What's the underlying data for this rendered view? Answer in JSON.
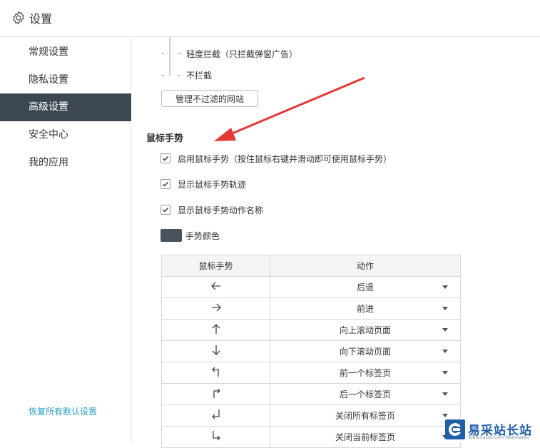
{
  "header": {
    "title": "设置",
    "icon": "gear-icon"
  },
  "sidebar": {
    "items": [
      {
        "label": "常规设置"
      },
      {
        "label": "隐私设置"
      },
      {
        "label": "高级设置"
      },
      {
        "label": "安全中心"
      },
      {
        "label": "我的应用"
      }
    ],
    "active_index": 2,
    "restore_label": "恢复所有默认设置"
  },
  "adblock": {
    "option_light": "轻度拦截（只拦截弹窗广告）",
    "option_none": "不拦截",
    "manage_button": "管理不过滤的网站"
  },
  "gesture": {
    "section_title": "鼠标手势",
    "enable_label": "启用鼠标手势（按住鼠标右键并滑动即可使用鼠标手势）",
    "trail_label": "显示鼠标手势轨迹",
    "name_label": "显示鼠标手势动作名称",
    "color_label": "手势颜色",
    "color": "#48535e",
    "table": {
      "col_gesture": "鼠标手势",
      "col_action": "动作",
      "rows": [
        {
          "gesture_icon": "arrow-left-icon",
          "action": "后退"
        },
        {
          "gesture_icon": "arrow-right-icon",
          "action": "前进"
        },
        {
          "gesture_icon": "arrow-up-icon",
          "action": "向上滚动页面"
        },
        {
          "gesture_icon": "arrow-down-icon",
          "action": "向下滚动页面"
        },
        {
          "gesture_icon": "arrow-up-left-icon",
          "action": "前一个标签页"
        },
        {
          "gesture_icon": "arrow-up-right-icon",
          "action": "后一个标签页"
        },
        {
          "gesture_icon": "arrow-down-left-icon",
          "action": "关闭所有标签页"
        },
        {
          "gesture_icon": "arrow-down-right-icon",
          "action": "关闭当前标签页"
        }
      ]
    }
  },
  "watermark": {
    "text": "易采站长站",
    "sub": "Www.Easck.Com Webmaster"
  },
  "colors": {
    "accent": "#3d4752",
    "link": "#2aa0c8"
  }
}
